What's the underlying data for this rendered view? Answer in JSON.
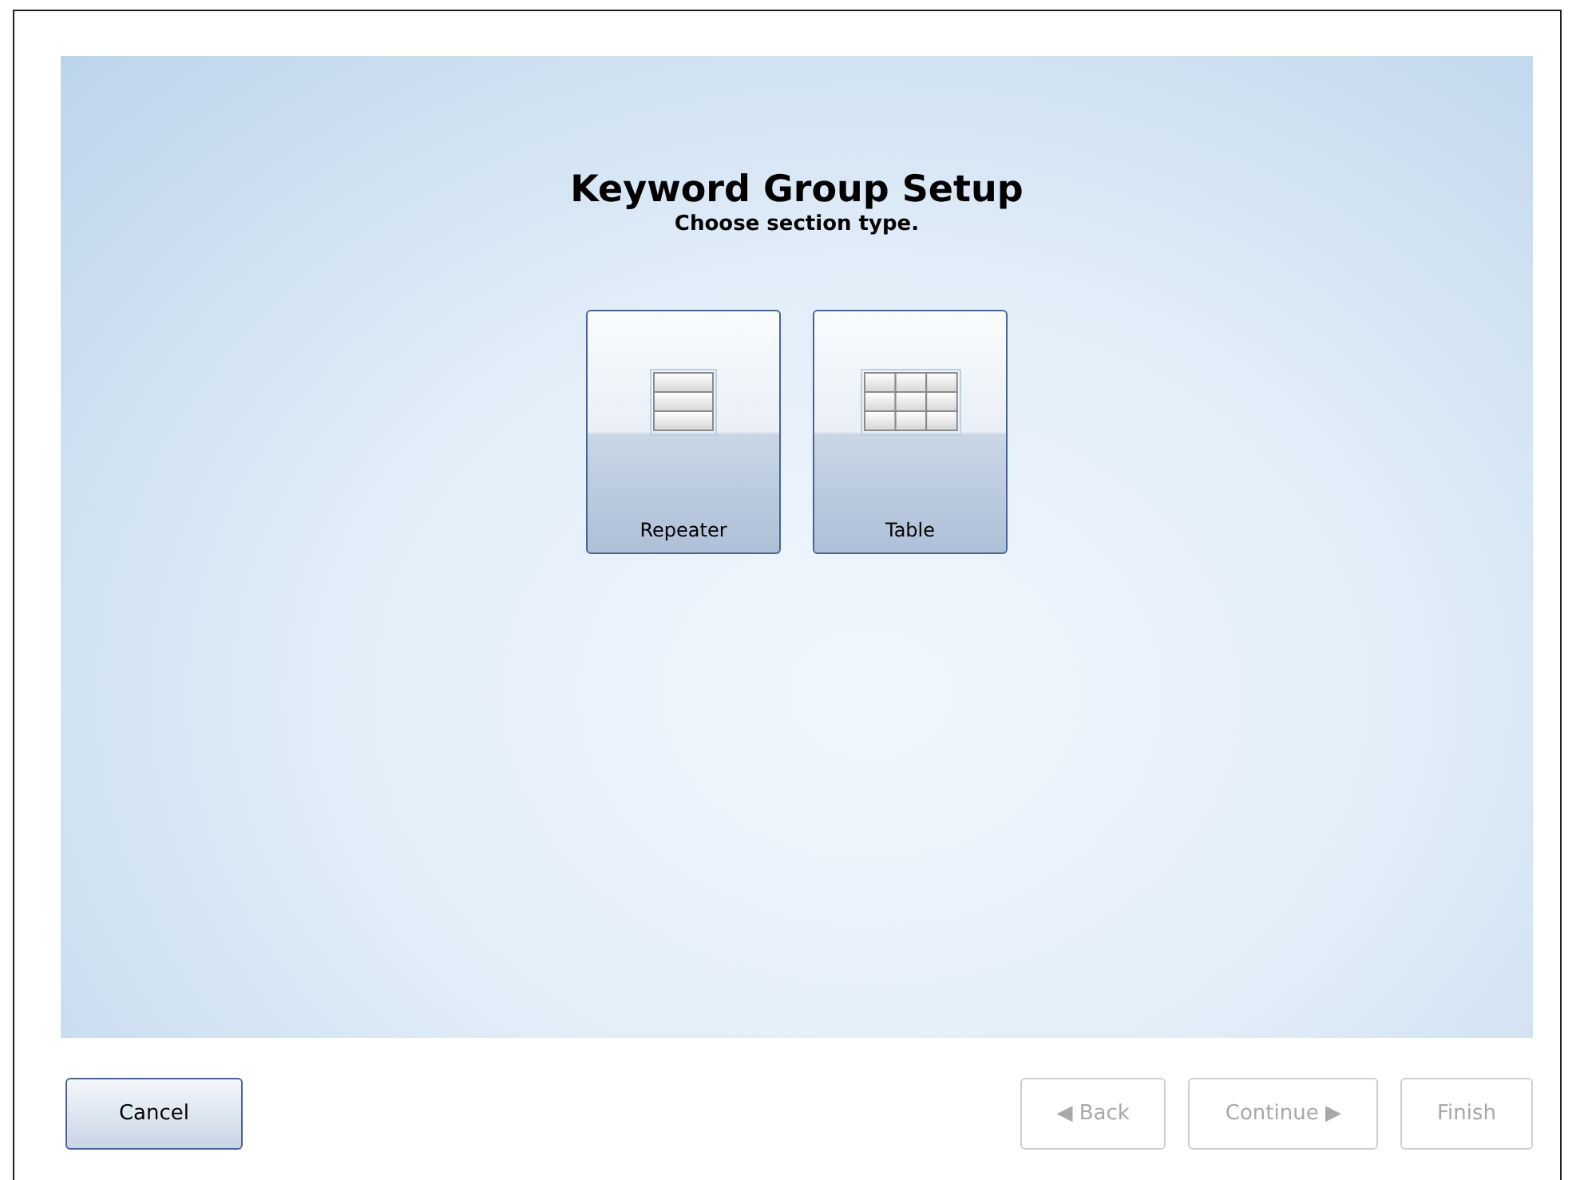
{
  "title": "Keyword Group Setup",
  "subtitle": "Choose section type.",
  "options": [
    {
      "label": "Repeater",
      "kind": "repeater"
    },
    {
      "label": "Table",
      "kind": "table"
    }
  ],
  "cancel": {
    "label": "Cancel",
    "disabled": false
  },
  "nav_buttons": [
    {
      "label": "◀ Back",
      "disabled": true
    },
    {
      "label": "Continue ▶",
      "disabled": true
    },
    {
      "label": "Finish",
      "disabled": true
    }
  ]
}
